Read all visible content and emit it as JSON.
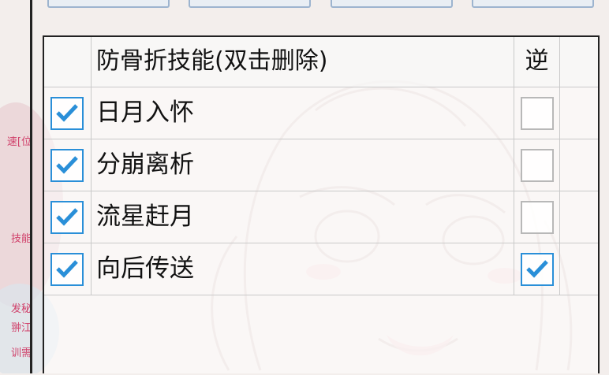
{
  "table": {
    "header": {
      "skill_col": "防骨折技能(双击删除)",
      "reverse_col": "逆"
    },
    "rows": [
      {
        "name": "日月入怀",
        "enabled": true,
        "reverse": false
      },
      {
        "name": "分崩离析",
        "enabled": true,
        "reverse": false
      },
      {
        "name": "流星赶月",
        "enabled": true,
        "reverse": false
      },
      {
        "name": "向后传送",
        "enabled": true,
        "reverse": true
      }
    ]
  },
  "left_strip": {
    "texts": [
      "速[位",
      "技能",
      "发秘",
      "翀江",
      "训需"
    ]
  },
  "colors": {
    "check": "#2a8fd8",
    "strip_text": "#d0406a",
    "frame": "#222222"
  },
  "icons": {
    "checked": "checkmark-icon"
  }
}
